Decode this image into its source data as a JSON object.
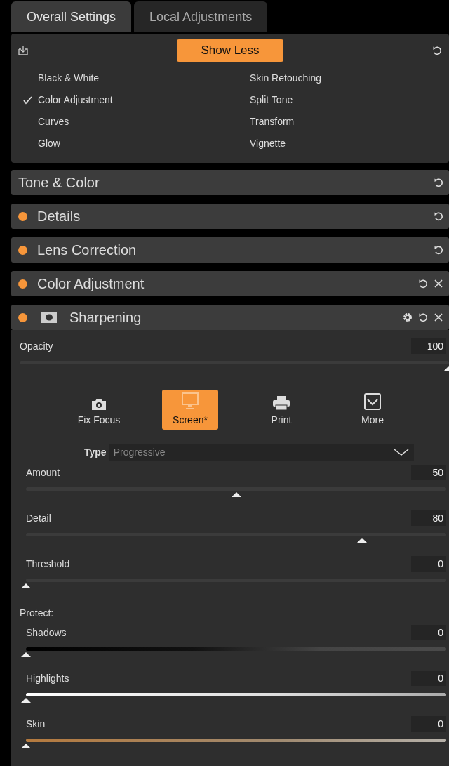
{
  "tabs": [
    {
      "label": "Overall Settings",
      "selected": true
    },
    {
      "label": "Local Adjustments",
      "selected": false
    }
  ],
  "tool_panel": {
    "button": "Show Less",
    "items": [
      {
        "label": "Black & White",
        "checked": false
      },
      {
        "label": "Color Adjustment",
        "checked": true
      },
      {
        "label": "Curves",
        "checked": false
      },
      {
        "label": "Glow",
        "checked": false
      },
      {
        "label": "Skin Retouching",
        "checked": false
      },
      {
        "label": "Split Tone",
        "checked": false
      },
      {
        "label": "Transform",
        "checked": false
      },
      {
        "label": "Vignette",
        "checked": false
      }
    ]
  },
  "sections": [
    {
      "title": "Tone & Color",
      "modified": false,
      "mask": false,
      "actions": [
        {
          "kind": "reset"
        }
      ]
    },
    {
      "title": "Details",
      "modified": true,
      "mask": false,
      "actions": [
        {
          "kind": "reset"
        }
      ]
    },
    {
      "title": "Lens Correction",
      "modified": true,
      "mask": false,
      "actions": [
        {
          "kind": "reset"
        }
      ]
    },
    {
      "title": "Color Adjustment",
      "modified": true,
      "mask": false,
      "actions": [
        {
          "kind": "reset"
        },
        {
          "kind": "close"
        }
      ]
    },
    {
      "title": "Sharpening",
      "modified": true,
      "mask": true,
      "actions": [
        {
          "kind": "settings"
        },
        {
          "kind": "reset"
        },
        {
          "kind": "close"
        }
      ]
    }
  ],
  "sharpening": {
    "opacity": {
      "label": "Opacity",
      "value": "100",
      "level": 1.0
    },
    "presets": [
      {
        "label": "Fix Focus",
        "kind": "camera",
        "selected": false
      },
      {
        "label": "Screen*",
        "kind": "monitor",
        "selected": true
      },
      {
        "label": "Print",
        "kind": "printer",
        "selected": false
      },
      {
        "label": "More",
        "kind": "more",
        "selected": false
      }
    ],
    "type": {
      "label": "Type",
      "value": "Progressive"
    },
    "sliders": [
      {
        "label": "Amount",
        "value": "50",
        "level": 0.5
      },
      {
        "label": "Detail",
        "value": "80",
        "level": 0.8
      },
      {
        "label": "Threshold",
        "value": "0",
        "level": 0.0
      }
    ],
    "protect_label": "Protect:",
    "protect": [
      {
        "label": "Shadows",
        "value": "0",
        "level": 0.0,
        "kind": "shadows"
      },
      {
        "label": "Highlights",
        "value": "0",
        "level": 0.0,
        "kind": "highlights"
      },
      {
        "label": "Skin",
        "value": "0",
        "level": 0.0,
        "kind": "skin"
      }
    ]
  }
}
